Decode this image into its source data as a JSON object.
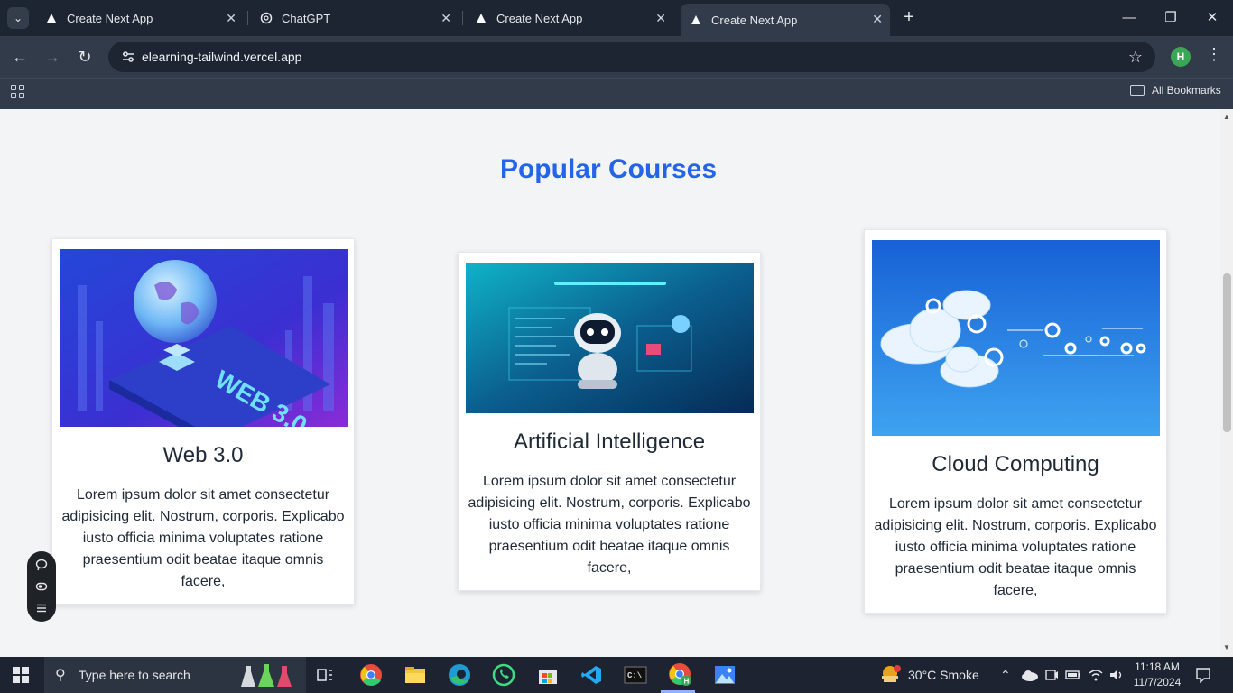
{
  "browser": {
    "tabs": [
      {
        "label": "Create Next App",
        "icon": "nextjs-triangle-icon",
        "active": false
      },
      {
        "label": "ChatGPT",
        "icon": "chatgpt-icon",
        "active": false
      },
      {
        "label": "Create Next App",
        "icon": "nextjs-triangle-icon",
        "active": false
      },
      {
        "label": "Create Next App",
        "icon": "nextjs-triangle-icon",
        "active": true
      }
    ],
    "url": "elearning-tailwind.vercel.app",
    "profile_initial": "H",
    "bookmarks_label": "All Bookmarks"
  },
  "page": {
    "section_title": "Popular Courses",
    "courses": [
      {
        "title": "Web 3.0",
        "description": "Lorem ipsum dolor sit amet consectetur adipisicing elit. Nostrum, corporis. Explicabo iusto officia minima voluptates ratione praesentium odit beatae itaque omnis facere,",
        "image": "web3-globe-illustration",
        "image_text": "WEB 3.0"
      },
      {
        "title": "Artificial Intelligence",
        "description": "Lorem ipsum dolor sit amet consectetur adipisicing elit. Nostrum, corporis. Explicabo iusto officia minima voluptates ratione praesentium odit beatae itaque omnis facere,",
        "image": "ai-robot-illustration"
      },
      {
        "title": "Cloud Computing",
        "description": "Lorem ipsum dolor sit amet consectetur adipisicing elit. Nostrum, corporis. Explicabo iusto officia minima voluptates ratione praesentium odit beatae itaque omnis facere,",
        "image": "cloud-gears-illustration"
      }
    ]
  },
  "taskbar": {
    "search_placeholder": "Type here to search",
    "weather": "30°C  Smoke",
    "time": "11:18 AM",
    "date": "11/7/2024"
  },
  "colors": {
    "accent": "#2563eb",
    "browser_dark": "#1d2533",
    "toolbar": "#323b4a",
    "page_bg": "#f3f4f6"
  }
}
